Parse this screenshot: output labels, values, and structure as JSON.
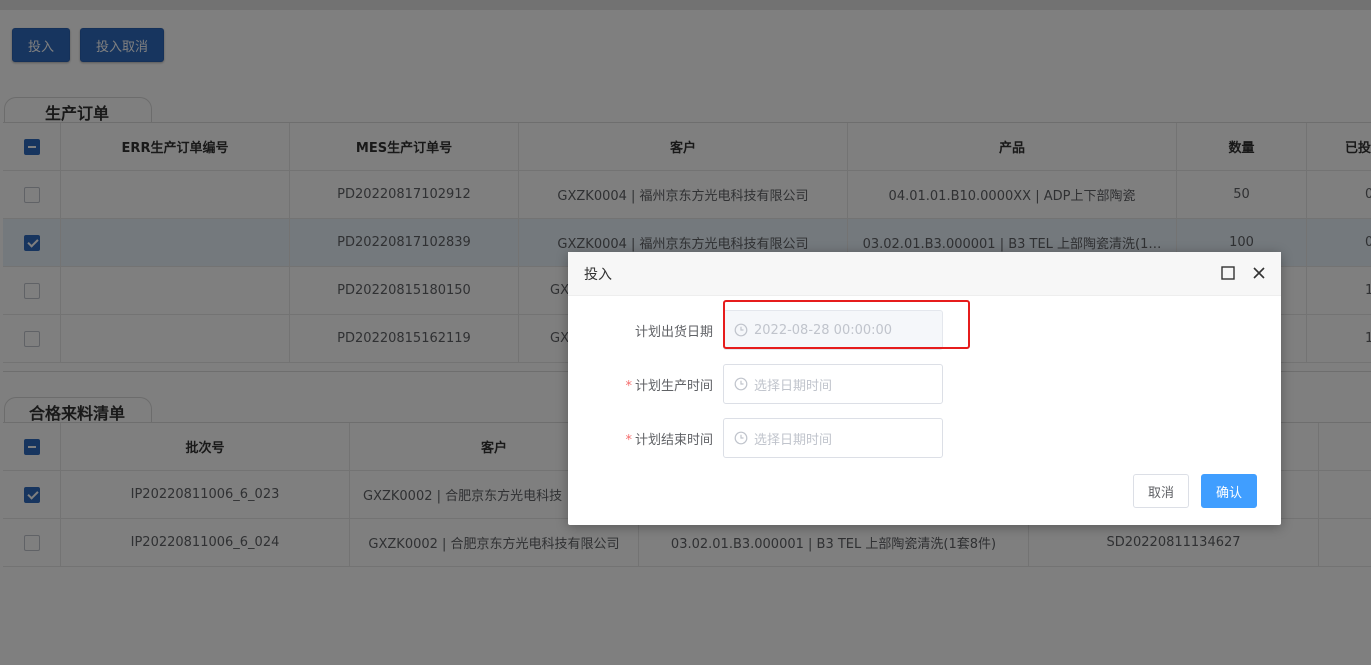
{
  "toolbar": {
    "invest_label": "投入",
    "invest_cancel_label": "投入取消"
  },
  "production_orders": {
    "tab_label": "生产订单",
    "columns": [
      "ERR生产订单编号",
      "MES生产订单号",
      "客户",
      "产品",
      "数量",
      "已投"
    ],
    "rows": [
      {
        "err_no": "",
        "mes_no": "PD20220817102912",
        "customer": "GXZK0004 | 福州京东方光电科技有限公司",
        "product": "04.01.01.B10.0000XX | ADP上下部陶瓷",
        "qty": "50",
        "invested": "0",
        "checked": false
      },
      {
        "err_no": "",
        "mes_no": "PD20220817102839",
        "customer": "GXZK0004 | 福州京东方光电科技有限公司",
        "product": "03.02.01.B3.000001 | B3 TEL 上部陶瓷清洗(1…",
        "qty": "100",
        "invested": "0",
        "checked": true
      },
      {
        "err_no": "",
        "mes_no": "PD20220815180150",
        "customer": "GX",
        "product": "",
        "qty": "",
        "invested": "1",
        "checked": false
      },
      {
        "err_no": "",
        "mes_no": "PD20220815162119",
        "customer": "GX",
        "product": "",
        "qty": "",
        "invested": "1",
        "checked": false
      }
    ]
  },
  "qualified_materials": {
    "tab_label": "合格来料清单",
    "columns": [
      "批次号",
      "客户",
      "",
      ""
    ],
    "rows": [
      {
        "batch": "IP20220811006_6_023",
        "customer": "GXZK0002 | 合肥京东方光电科技",
        "product": "",
        "order": "",
        "checked": true
      },
      {
        "batch": "IP20220811006_6_024",
        "customer": "GXZK0002 | 合肥京东方光电科技有限公司",
        "product": "03.02.01.B3.000001 | B3 TEL 上部陶瓷清洗(1套8件)",
        "order": "SD20220811134627",
        "checked": false
      }
    ]
  },
  "dialog": {
    "title": "投入",
    "fields": [
      {
        "label": "计划出货日期",
        "required": false,
        "value": "2022-08-28 00:00:00",
        "placeholder": "",
        "disabled": true
      },
      {
        "label": "计划生产时间",
        "required": true,
        "value": "",
        "placeholder": "选择日期时间",
        "disabled": false
      },
      {
        "label": "计划结束时间",
        "required": true,
        "value": "",
        "placeholder": "选择日期时间",
        "disabled": false
      }
    ],
    "cancel_label": "取消",
    "confirm_label": "确认"
  },
  "icons": {
    "maximize": "maximize-icon",
    "close": "close-icon",
    "clock": "clock-icon"
  },
  "colors": {
    "accent_dark": "#2f6bbf",
    "primary": "#409eff",
    "highlight": "#e61c1c",
    "required": "#f56c6c"
  }
}
